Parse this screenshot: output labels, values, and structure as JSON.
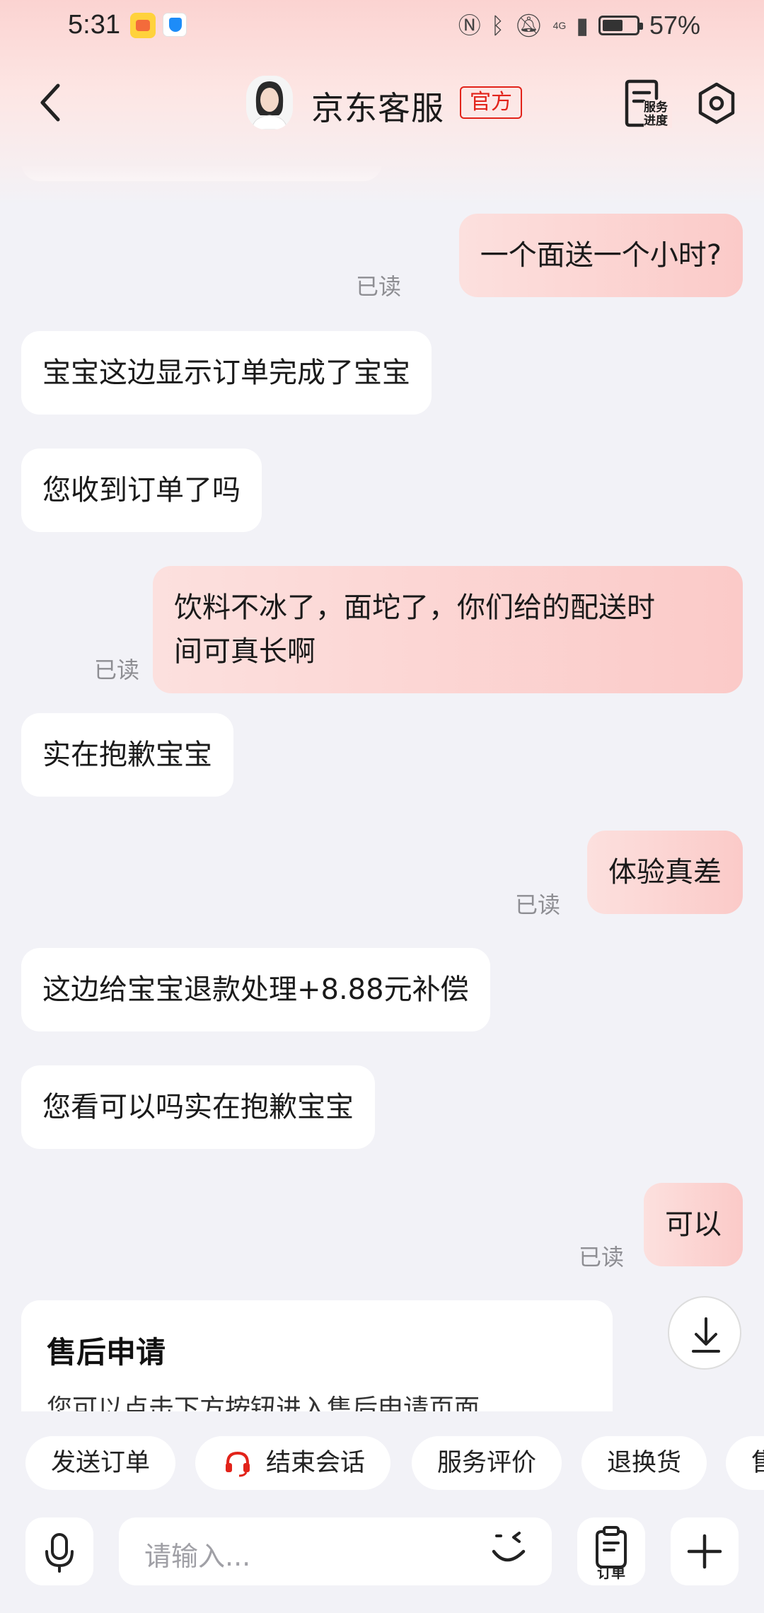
{
  "status_bar": {
    "time": "5:31",
    "battery": "57%",
    "network": "4G"
  },
  "header": {
    "title": "京东客服",
    "badge": "官方",
    "service_progress_label": "服务进度"
  },
  "messages": [
    {
      "side": "in",
      "text": ""
    },
    {
      "side": "out",
      "text": "一个面送一个小时?",
      "status": "已读"
    },
    {
      "side": "in",
      "text": "宝宝这边显示订单完成了宝宝"
    },
    {
      "side": "in",
      "text": "您收到订单了吗"
    },
    {
      "side": "out",
      "line1": "饮料不冰了，面坨了，你们给的配送时",
      "line2": "间可真长啊",
      "status": "已读"
    },
    {
      "side": "in",
      "text": "实在抱歉宝宝"
    },
    {
      "side": "out",
      "text": "体验真差",
      "status": "已读"
    },
    {
      "side": "in",
      "text": "这边给宝宝退款处理+8.88元补偿"
    },
    {
      "side": "in",
      "text": "您看可以吗实在抱歉宝宝"
    },
    {
      "side": "out",
      "text": "可以",
      "status": "已读"
    }
  ],
  "card": {
    "title": "售后申请",
    "description": "您可以点击下方按钮进入售后申请页面"
  },
  "quick_actions": [
    "发送订单",
    "结束会话",
    "服务评价",
    "退换货",
    "售"
  ],
  "input": {
    "placeholder": "请输入...",
    "order_label": "订单"
  },
  "colors": {
    "brand_red": "#e2231a",
    "outgoing_bubble": "#fbd2d0",
    "background": "#f2f2f7"
  }
}
